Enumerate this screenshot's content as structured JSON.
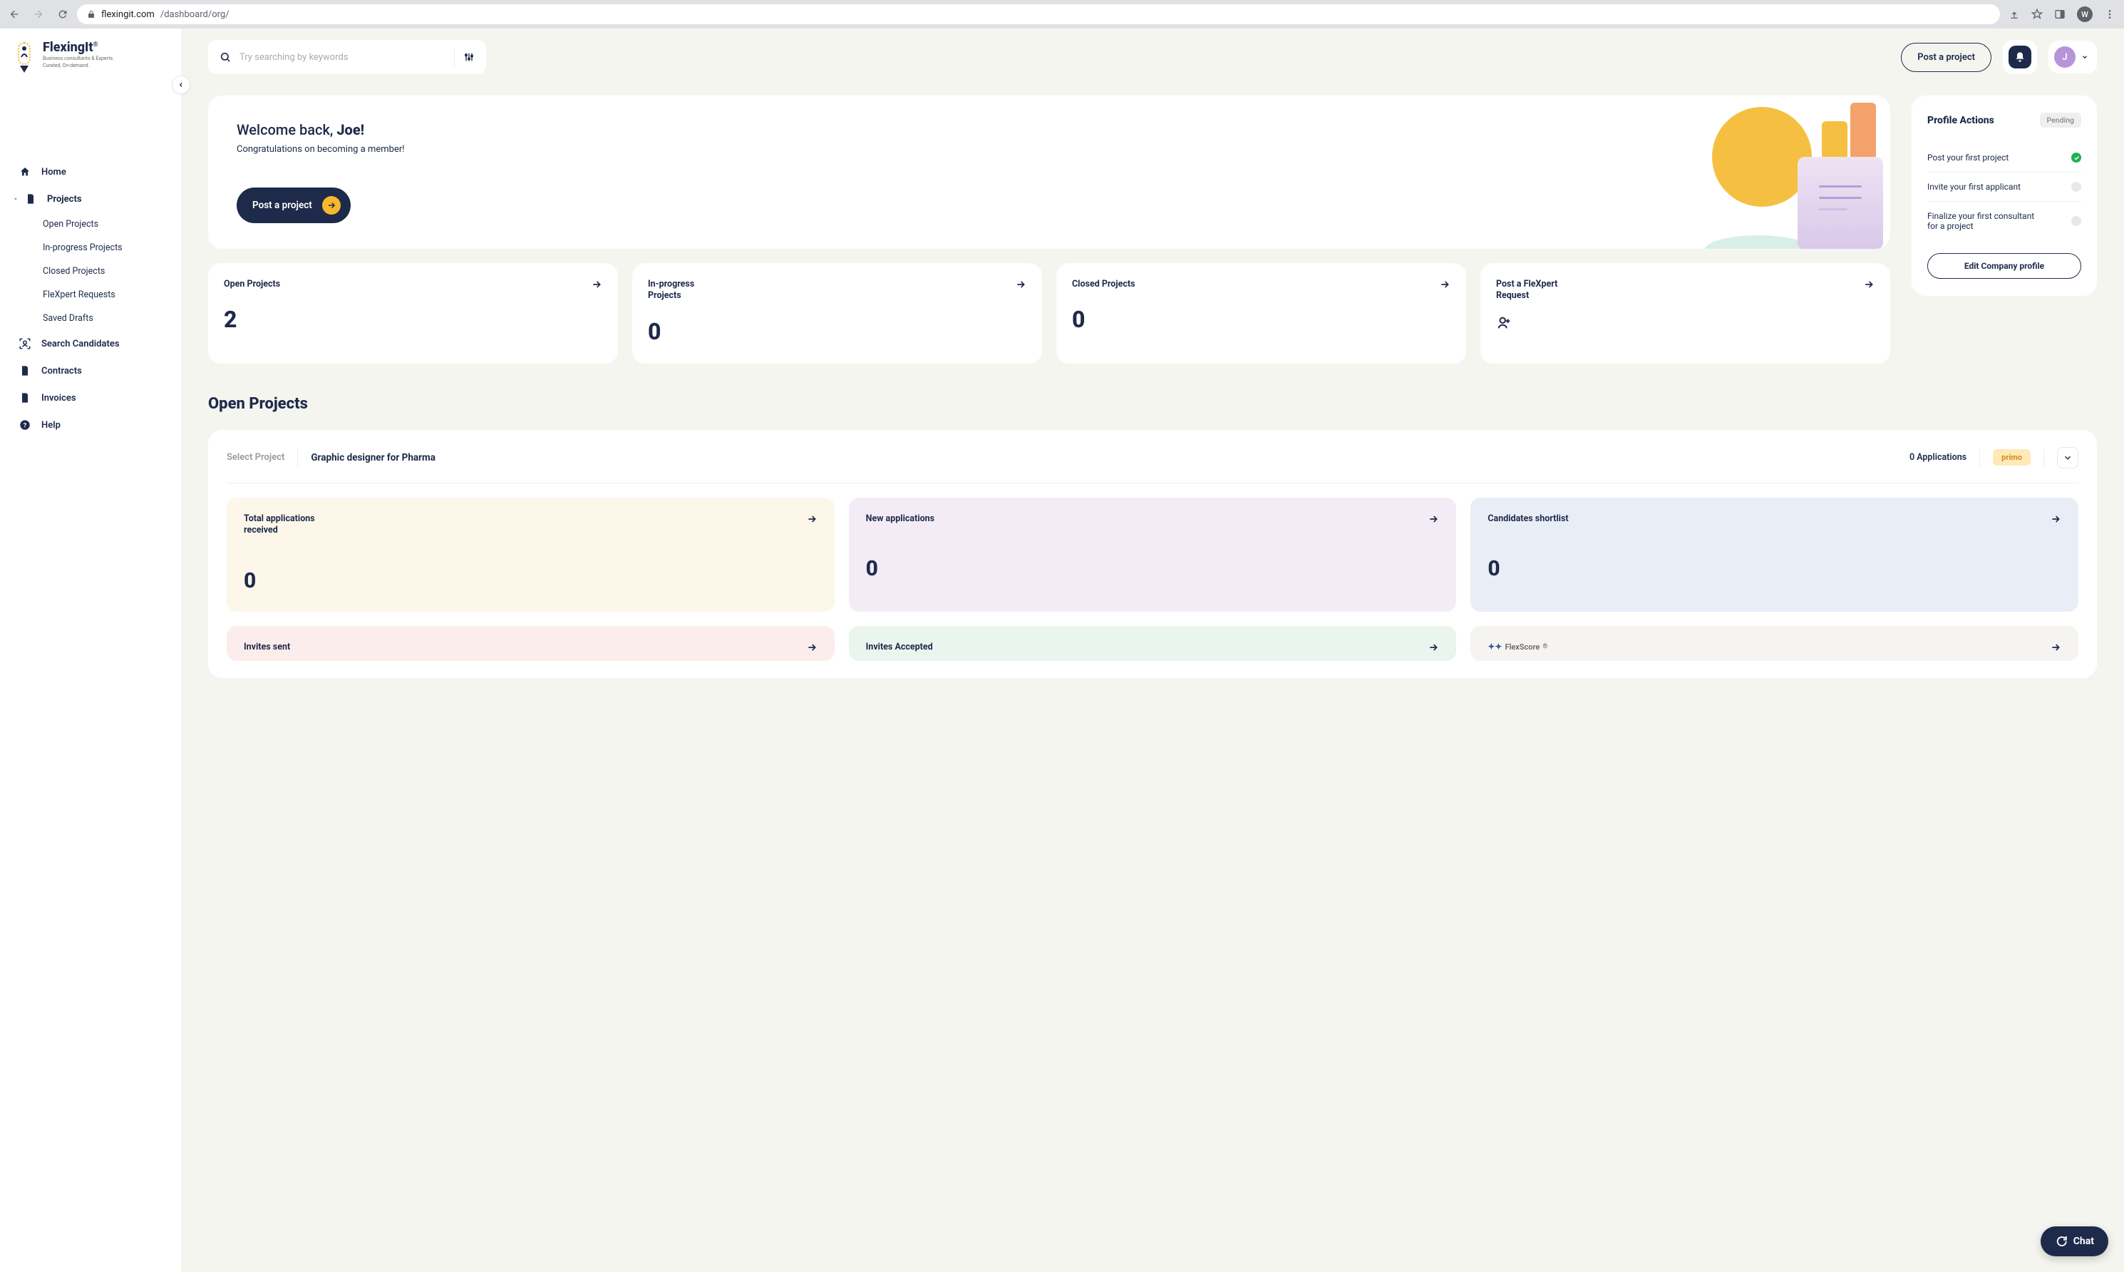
{
  "browser": {
    "url_host": "flexingit.com",
    "url_path": "/dashboard/org/",
    "avatar_letter": "W"
  },
  "logo": {
    "name": "FlexingIt",
    "reg": "®",
    "tag1": "Business consultants & Experts.",
    "tag2": "Curated, On-demand."
  },
  "sidebar": {
    "items": [
      {
        "label": "Home"
      },
      {
        "label": "Projects"
      },
      {
        "label": "Search Candidates"
      },
      {
        "label": "Contracts"
      },
      {
        "label": "Invoices"
      },
      {
        "label": "Help"
      }
    ],
    "sub_projects": [
      {
        "label": "Open Projects"
      },
      {
        "label": "In-progress Projects"
      },
      {
        "label": "Closed Projects"
      },
      {
        "label": "FleXpert Requests"
      },
      {
        "label": "Saved Drafts"
      }
    ]
  },
  "topbar": {
    "search_placeholder": "Try searching by keywords",
    "post_btn": "Post a project"
  },
  "user": {
    "initial": "J"
  },
  "welcome": {
    "prefix": "Welcome back, ",
    "name": "Joe!",
    "sub": "Congratulations on becoming a member!",
    "cta": "Post a project"
  },
  "stats": [
    {
      "label": "Open Projects",
      "value": "2"
    },
    {
      "label": "In-progress Projects",
      "value": "0"
    },
    {
      "label": "Closed Projects",
      "value": "0"
    },
    {
      "label": "Post a FleXpert Request",
      "value": ""
    }
  ],
  "profile": {
    "title": "Profile Actions",
    "badge": "Pending",
    "actions": [
      {
        "label": "Post your first project",
        "done": true
      },
      {
        "label": "Invite your first applicant",
        "done": false
      },
      {
        "label": "Finalize your first consultant for a project",
        "done": false
      }
    ],
    "edit_btn": "Edit Company profile"
  },
  "open_projects": {
    "title": "Open Projects",
    "select_label": "Select Project",
    "project_name": "Graphic designer for Pharma",
    "apps_count": "0 Applications",
    "badge": "primo",
    "cards": [
      {
        "label": "Total applications received",
        "value": "0",
        "color": "yellow"
      },
      {
        "label": "New applications",
        "value": "0",
        "color": "purple"
      },
      {
        "label": "Candidates shortlist",
        "value": "0",
        "color": "blue"
      }
    ],
    "cards2": [
      {
        "label": "Invites sent",
        "color": "pink"
      },
      {
        "label": "Invites Accepted",
        "color": "green"
      },
      {
        "label_special": "FlexScore",
        "sup": "®",
        "color": "gray"
      }
    ]
  },
  "chat": {
    "label": "Chat"
  }
}
